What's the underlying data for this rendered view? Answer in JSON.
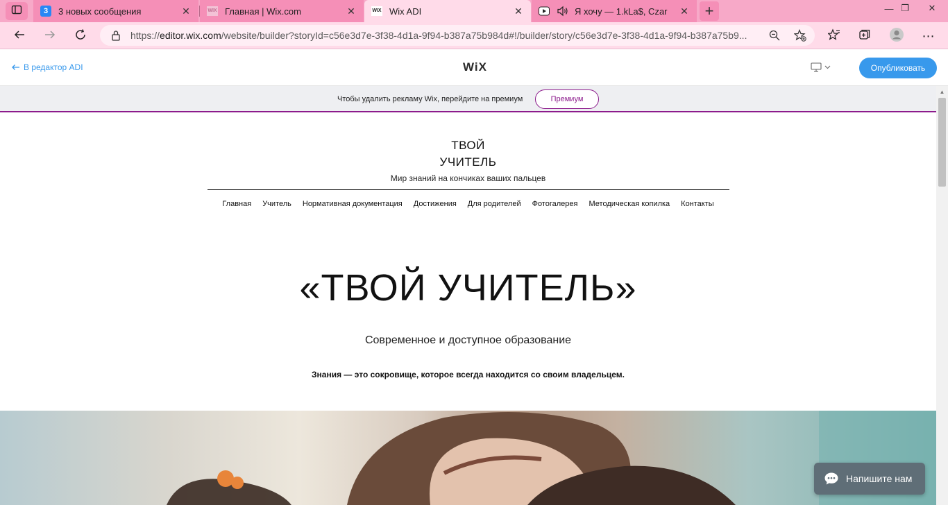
{
  "browser": {
    "tabs": [
      {
        "title": "3 новых сообщения",
        "badge": "3",
        "favicon": "vk-icon"
      },
      {
        "title": "Главная | Wix.com",
        "favicon": "wix-icon",
        "favicon_text": "WIX"
      },
      {
        "title": "Wix ADI",
        "favicon": "wix-icon",
        "favicon_text": "WIX",
        "active": true
      },
      {
        "title": "Я хочу — 1.kLa$, Czar",
        "favicon": "youtube-icon",
        "playing": true
      }
    ],
    "url": {
      "prefix": "https://",
      "host": "editor.wix.com",
      "path": "/website/builder?storyId=c56e3d7e-3f38-4d1a-9f94-b387a75b984d#!/builder/story/c56e3d7e-3f38-4d1a-9f94-b387a75b9..."
    }
  },
  "editor": {
    "back_label": "В редактор ADI",
    "logo": "WiX",
    "publish_label": "Опубликовать"
  },
  "premium": {
    "text": "Чтобы удалить рекламу Wix, перейдите на премиум",
    "button": "Премиум"
  },
  "site": {
    "title_line1": "ТВОЙ",
    "title_line2": "УЧИТЕЛЬ",
    "tagline": "Мир знаний на кончиках ваших пальцев",
    "nav": [
      "Главная",
      "Учитель",
      "Нормативная документация",
      "Достижения",
      "Для родителей",
      "Фотогалерея",
      "Методическая копилка",
      "Контакты"
    ],
    "hero_title": "«ТВОЙ УЧИТЕЛЬ»",
    "hero_subtitle": "Современное и доступное образование",
    "hero_quote": "Знания — это сокровище, которое всегда находится со своим владельцем."
  },
  "chat": {
    "label": "Напишите нам"
  },
  "colors": {
    "tabbar": "#f7a9c8",
    "toolbar": "#ffdbe9",
    "accent": "#3899ec",
    "premium": "#8c1b8c",
    "chat": "#5f6e77"
  }
}
